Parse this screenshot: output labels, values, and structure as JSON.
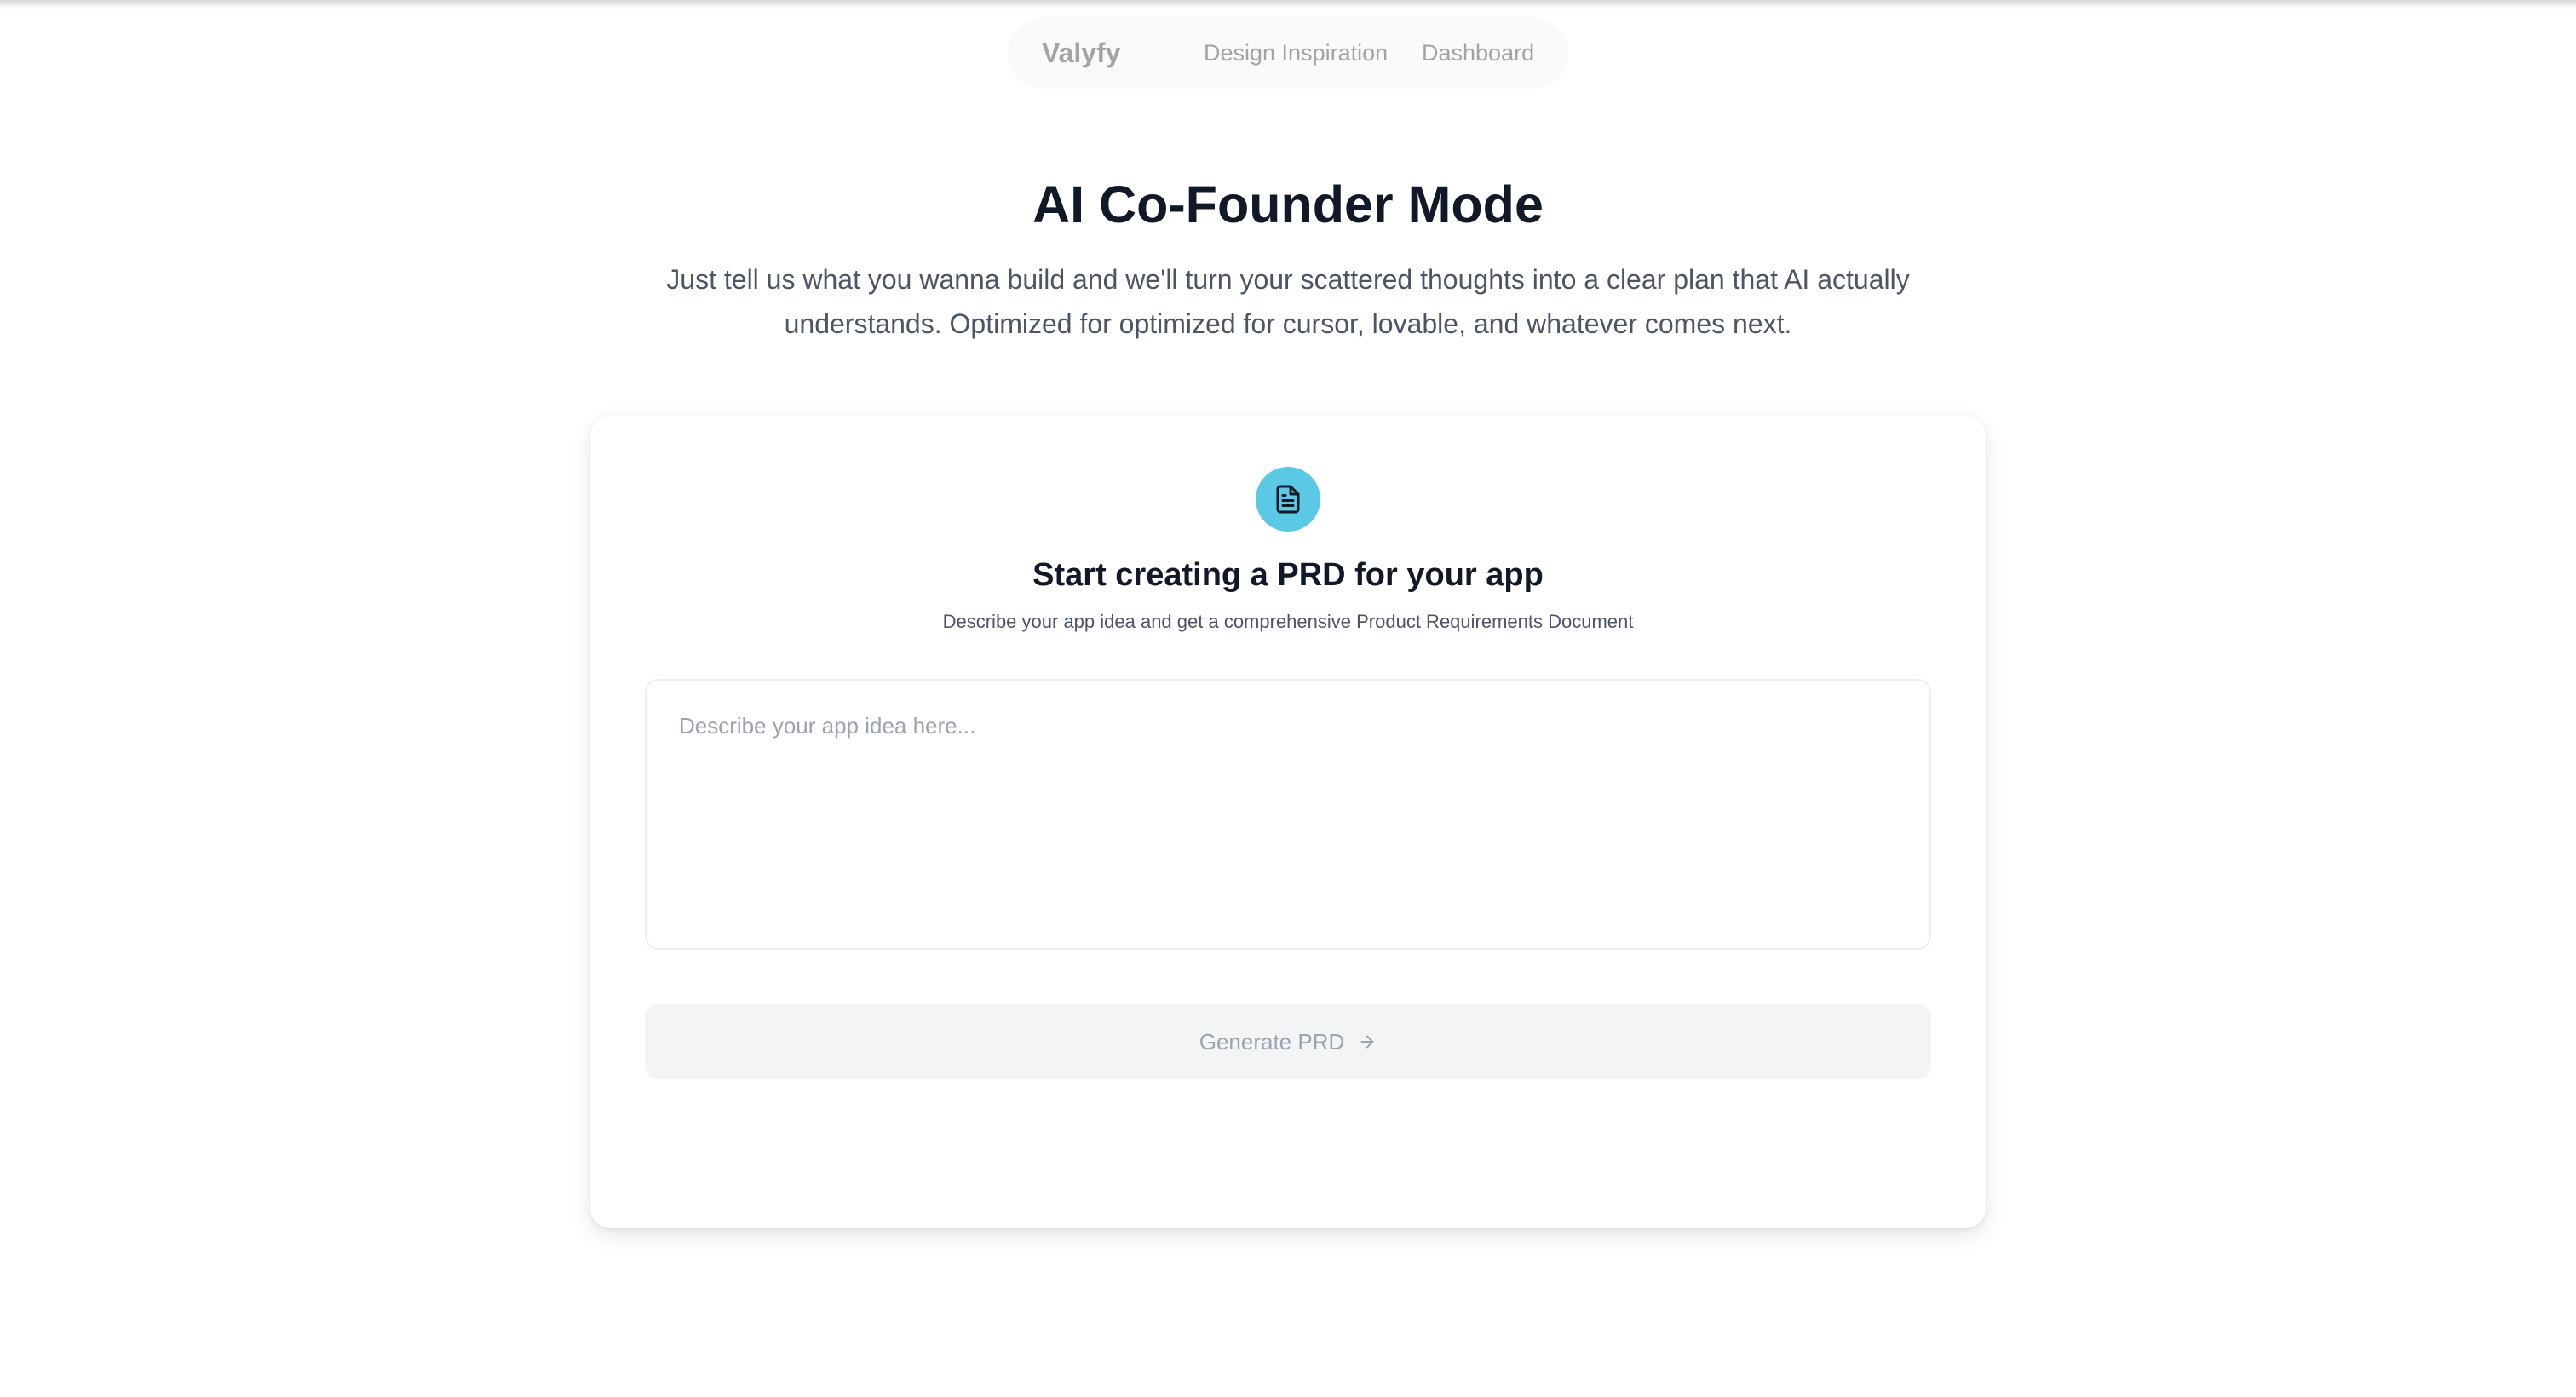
{
  "nav": {
    "brand": "Valyfy",
    "links": [
      {
        "label": "Design Inspiration"
      },
      {
        "label": "Dashboard"
      }
    ]
  },
  "hero": {
    "title": "AI Co-Founder Mode",
    "subtitle": "Just tell us what you wanna build and we'll turn your scattered thoughts into a clear plan that AI actually understands. Optimized for optimized for cursor, lovable, and whatever comes next."
  },
  "card": {
    "icon": "document-icon",
    "icon_bg_color": "#5bc8e5",
    "title": "Start creating a PRD for your app",
    "description": "Describe your app idea and get a comprehensive Product Requirements Document",
    "input": {
      "value": "",
      "placeholder": "Describe your app idea here..."
    },
    "generate_button": {
      "label": "Generate PRD",
      "icon": "arrow-right-icon",
      "disabled": true
    }
  }
}
